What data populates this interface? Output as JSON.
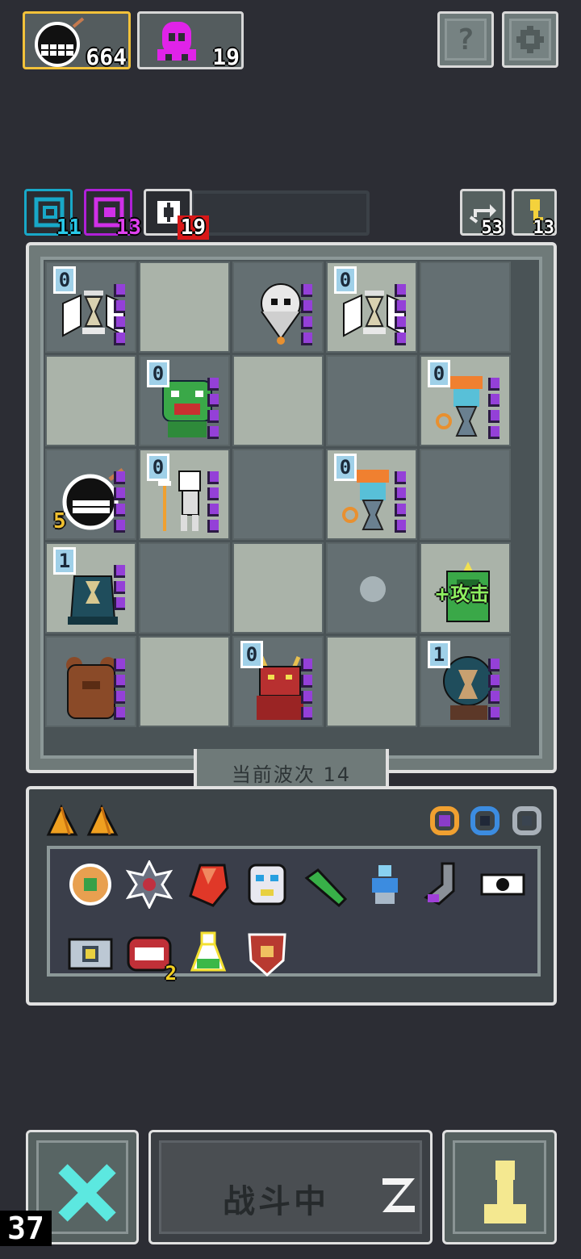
{
  "top_bar": {
    "coins": {
      "icon": "bomb-face-icon",
      "value": "664"
    },
    "gems": {
      "icon": "magenta-ghost-icon",
      "value": "19"
    },
    "help_button": {
      "icon": "question-mark-icon",
      "label": "?"
    },
    "settings_button": {
      "icon": "gear-icon"
    }
  },
  "counters": {
    "cyan": {
      "icon": "cyan-swirl-icon",
      "value": "11",
      "color": "#18a8c8"
    },
    "magenta": {
      "icon": "magenta-swirl-icon",
      "value": "13",
      "color": "#b020d8"
    },
    "red": {
      "icon": "sparkle-icon",
      "value": "19",
      "color": "#e01818"
    },
    "refresh": {
      "icon": "refresh-arrows-icon",
      "value": "53"
    },
    "key": {
      "icon": "key-icon",
      "value": "13"
    }
  },
  "board": {
    "rows": [
      [
        {
          "unit": "white-winged-hourglass",
          "level": "0",
          "stars": 4
        },
        {
          "unit": null
        },
        {
          "unit": "white-skull-mask",
          "level": null,
          "stars": 4
        },
        {
          "unit": "white-winged-hourglass",
          "level": "0",
          "stars": 4
        },
        {
          "unit": null
        }
      ],
      [
        {
          "unit": null
        },
        {
          "unit": "green-goblin",
          "level": "0",
          "stars": 4
        },
        {
          "unit": null
        },
        {
          "unit": null
        },
        {
          "unit": "orange-hair-hourglass",
          "level": "0",
          "stars": 4
        }
      ],
      [
        {
          "unit": "bomb-face",
          "level": null,
          "badge": "5",
          "stars": 4
        },
        {
          "unit": "skeleton-mage",
          "level": "0",
          "stars": 4
        },
        {
          "unit": null
        },
        {
          "unit": "orange-hair-hourglass",
          "level": "0",
          "stars": 4
        },
        {
          "unit": null
        }
      ],
      [
        {
          "unit": "teal-hourglass-golem",
          "level": "1",
          "stars": 3
        },
        {
          "unit": null
        },
        {
          "unit": null
        },
        {
          "unit": "empty-ghost",
          "level": null,
          "stars": 0
        },
        {
          "unit": "green-attack-buff",
          "level": null,
          "stars": 0,
          "text": "+攻击"
        }
      ],
      [
        {
          "unit": "brown-bear",
          "level": null,
          "stars": 4
        },
        {
          "unit": null
        },
        {
          "unit": "red-demon",
          "level": "0",
          "stars": 4
        },
        {
          "unit": null
        },
        {
          "unit": "teal-hourglass-knight",
          "level": "1",
          "stars": 4
        }
      ]
    ],
    "wave_label": "当前波次 14"
  },
  "inventory": {
    "top_left_items": [
      "orange-shard-icon",
      "orange-shard-icon"
    ],
    "top_right_rings": [
      "orange-ring-icon",
      "blue-ring-icon",
      "grey-ring-icon"
    ],
    "items": [
      {
        "icon": "crossed-shield-icon"
      },
      {
        "icon": "spiked-gear-icon"
      },
      {
        "icon": "red-crystal-icon"
      },
      {
        "icon": "tribal-mask-icon"
      },
      {
        "icon": "green-horn-icon"
      },
      {
        "icon": "blue-robot-icon"
      },
      {
        "icon": "purple-sock-icon"
      },
      {
        "icon": "watch-eye-icon"
      },
      {
        "icon": "camera-box-icon"
      },
      {
        "icon": "red-mouth-icon",
        "count": "2"
      },
      {
        "icon": "potion-flask-icon"
      },
      {
        "icon": "bull-shield-icon"
      }
    ]
  },
  "bottom": {
    "cancel_button": {
      "icon": "cyan-cross-icon"
    },
    "battle_button": {
      "label": "战斗中",
      "icon": "sleep-z-icon"
    },
    "pawn_button": {
      "icon": "yellow-pawn-icon"
    },
    "frame_counter": "37"
  }
}
